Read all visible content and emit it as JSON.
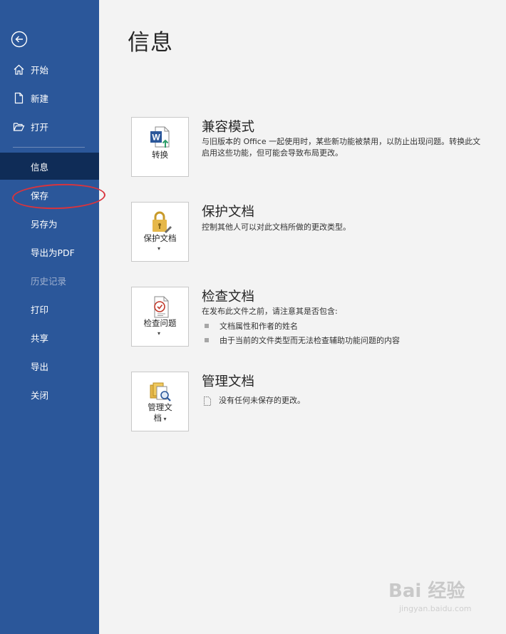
{
  "sidebar": {
    "back_icon": "back-arrow-circle-icon",
    "items": [
      {
        "label": "开始",
        "icon": "home-icon"
      },
      {
        "label": "新建",
        "icon": "new-document-icon"
      },
      {
        "label": "打开",
        "icon": "open-folder-icon"
      },
      {
        "label": "信息",
        "selected": true
      },
      {
        "label": "保存"
      },
      {
        "label": "另存为"
      },
      {
        "label": "导出为PDF"
      },
      {
        "label": "历史记录",
        "disabled": true
      },
      {
        "label": "打印"
      },
      {
        "label": "共享"
      },
      {
        "label": "导出"
      },
      {
        "label": "关闭"
      }
    ],
    "bg_color": "#2b579a",
    "selected_color": "#0f2c57"
  },
  "main": {
    "title": "信息",
    "sections": [
      {
        "tile_label": "转换",
        "tile_icon": "word-convert-icon",
        "title": "兼容模式",
        "desc_lines": [
          "与旧版本的 Office 一起使用时，某些新功能被禁用，以防止出现问题。转换此文",
          "启用这些功能，但可能会导致布局更改。"
        ]
      },
      {
        "tile_label": "保护文档",
        "tile_icon": "lock-icon",
        "title": "保护文档",
        "desc_lines": [
          "控制其他人可以对此文档所做的更改类型。"
        ]
      },
      {
        "tile_label": "检查问题",
        "tile_icon": "inspect-document-icon",
        "title": "检查文档",
        "desc_lines": [
          "在发布此文件之前，请注意其是否包含:"
        ],
        "bullets": [
          "文档属性和作者的姓名",
          "由于当前的文件类型而无法检查辅助功能问题的内容"
        ]
      },
      {
        "tile_label_line1": "管理文",
        "tile_label_line2": "档",
        "tile_icon": "manage-document-icon",
        "title": "管理文档",
        "desc_lines": [
          "没有任何未保存的更改。"
        ]
      }
    ]
  },
  "watermark": {
    "text": "Bai 经验",
    "sub": "jingyan.baidu.com"
  },
  "annotation_color": "#d9343d"
}
